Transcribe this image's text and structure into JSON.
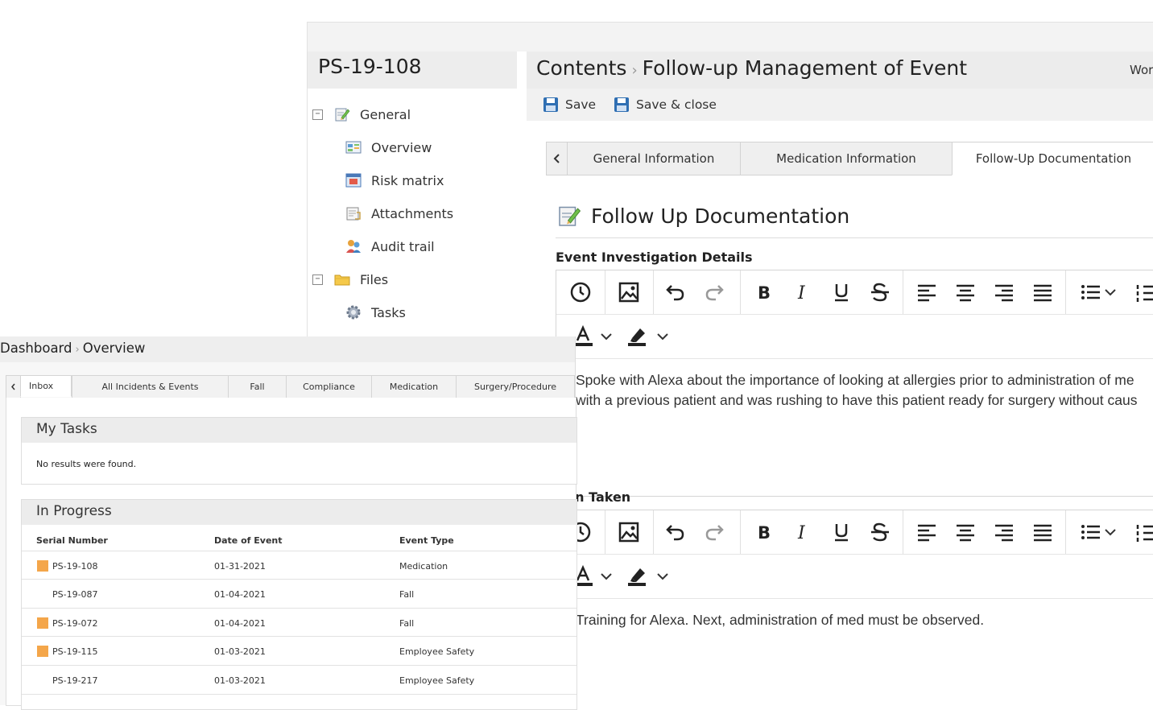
{
  "record": {
    "id": "PS-19-108",
    "tree": [
      {
        "label": "General",
        "icon": "notepad-pencil-icon",
        "level": 0,
        "toggle": "⊟"
      },
      {
        "label": "Overview",
        "icon": "overview-icon",
        "level": 1
      },
      {
        "label": "Risk matrix",
        "icon": "risk-matrix-icon",
        "level": 1
      },
      {
        "label": "Attachments",
        "icon": "attachments-icon",
        "level": 1
      },
      {
        "label": "Audit trail",
        "icon": "audit-trail-icon",
        "level": 1
      },
      {
        "label": "Files",
        "icon": "folder-icon",
        "level": 0,
        "toggle": "⊟"
      },
      {
        "label": "Tasks",
        "icon": "gear-icon",
        "level": 1
      }
    ]
  },
  "content": {
    "breadcrumb_root": "Contents",
    "breadcrumb_separator": "›",
    "breadcrumb_current": "Follow-up Management of Event",
    "right_label": "Wor",
    "toolbar": {
      "save_label": "Save",
      "save_close_label": "Save & close"
    },
    "tabs": [
      "General Information",
      "Medication Information",
      "Follow-Up Documentation"
    ],
    "active_tab": 2,
    "section_title": "Follow Up Documentation",
    "investigation_label": "Event Investigation Details",
    "investigation_text_1": "Spoke with Alexa about the importance of looking at allergies prior to administration of me",
    "investigation_text_2": "with a previous patient and was rushing to have this patient ready for surgery without caus",
    "action_label": "tion Taken",
    "action_text": "Training  for Alexa. Next, administration of med must be observed.",
    "editor_tools": [
      "history-icon",
      "image-icon",
      "undo-icon",
      "redo-icon",
      "bold-icon",
      "italic-icon",
      "underline-icon",
      "strikethrough-icon",
      "align-left-icon",
      "align-center-icon",
      "align-right-icon",
      "align-justify-icon",
      "bullet-list-icon",
      "numbered-list-icon",
      "font-color-icon",
      "highlight-icon"
    ]
  },
  "dashboard": {
    "breadcrumb_root": "Dashboard",
    "breadcrumb_separator": "›",
    "breadcrumb_current": "Overview",
    "tabs": [
      "Inbox",
      "All Incidents & Events",
      "Fall",
      "Compliance",
      "Medication",
      "Surgery/Procedure"
    ],
    "active_tab": 0,
    "my_tasks": {
      "title": "My Tasks",
      "empty_text": "No results were found."
    },
    "in_progress": {
      "title": "In Progress",
      "columns": [
        "Serial Number",
        "Date of Event",
        "Event Type"
      ],
      "rows": [
        {
          "serial": "PS-19-108",
          "date": "01-31-2021",
          "type": "Medication",
          "flag": true
        },
        {
          "serial": "PS-19-087",
          "date": "01-04-2021",
          "type": "Fall",
          "flag": false
        },
        {
          "serial": "PS-19-072",
          "date": "01-04-2021",
          "type": "Fall",
          "flag": true
        },
        {
          "serial": "PS-19-115",
          "date": "01-03-2021",
          "type": "Employee Safety",
          "flag": true
        },
        {
          "serial": "PS-19-217",
          "date": "01-03-2021",
          "type": "Employee Safety",
          "flag": false
        }
      ]
    }
  },
  "colors": {
    "flag": "#f4a64a",
    "save_icon": "#2f6fb3",
    "header_bg": "#ececec"
  }
}
